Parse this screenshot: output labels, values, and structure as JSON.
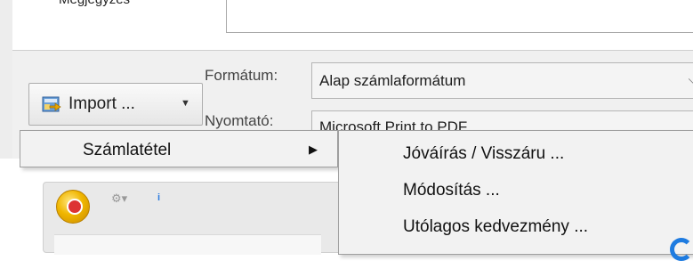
{
  "background_window": {
    "top_field_label": "Megjegyzés",
    "import_button_label": "Import ...",
    "format_label": "Formátum:",
    "format_value": "Alap számlaformátum",
    "printer_label": "Nyomtató:",
    "printer_value": "Microsoft Print to PDF"
  },
  "context_menu": {
    "items": [
      {
        "label": "Számlatétel",
        "has_submenu": true
      }
    ]
  },
  "submenu": {
    "items": [
      {
        "label": "Jóváírás / Visszáru ..."
      },
      {
        "label": "Módosítás ..."
      },
      {
        "label": "Utólagos kedvezmény ..."
      }
    ]
  },
  "icons": {
    "import": "import-icon",
    "app_orb": "app-orb-icon",
    "quick_access_gear": "gear-icon",
    "info": "info-icon"
  },
  "colors": {
    "accent_blue": "#1e7be0",
    "orb_gold": "#f0b600"
  }
}
